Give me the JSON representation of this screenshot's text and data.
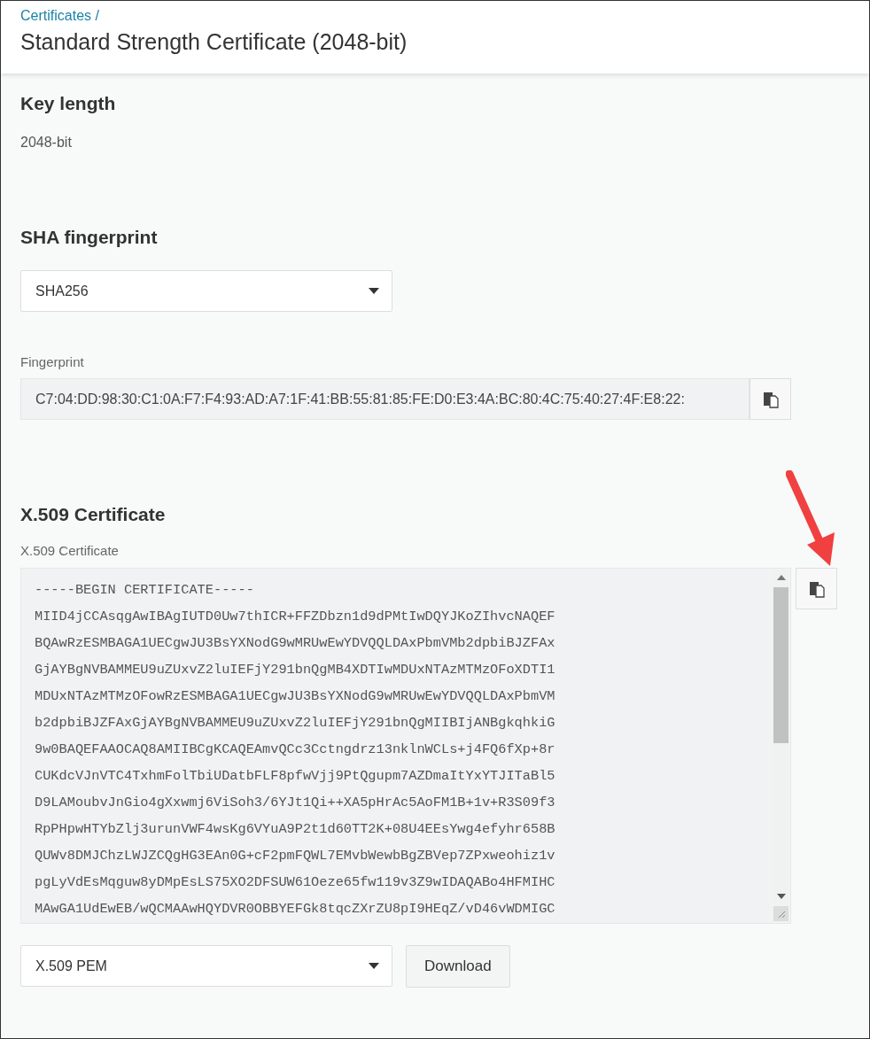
{
  "header": {
    "breadcrumb": "Certificates /",
    "title": "Standard Strength Certificate (2048-bit)"
  },
  "key_length": {
    "heading": "Key length",
    "value": "2048-bit"
  },
  "sha_fingerprint": {
    "heading": "SHA fingerprint",
    "algorithm": "SHA256",
    "field_label": "Fingerprint",
    "fingerprint": "C7:04:DD:98:30:C1:0A:F7:F4:93:AD:A7:1F:41:BB:55:81:85:FE:D0:E3:4A:BC:80:4C:75:40:27:4F:E8:22:"
  },
  "certificate": {
    "heading": "X.509 Certificate",
    "field_label": "X.509 Certificate",
    "lines": [
      "-----BEGIN CERTIFICATE-----",
      "MIID4jCCAsqgAwIBAgIUTD0Uw7thICR+FFZDbzn1d9dPMtIwDQYJKoZIhvcNAQEF",
      "BQAwRzESMBAGA1UECgwJU3BsYXNodG9wMRUwEwYDVQQLDAxPbmVMb2dpbiBJZFAx",
      "GjAYBgNVBAMMEU9uZUxvZ2luIEFjY291bnQgMB4XDTIwMDUxNTAzMTMzOFoXDTI1",
      "MDUxNTAzMTMzOFowRzESMBAGA1UECgwJU3BsYXNodG9wMRUwEwYDVQQLDAxPbmVM",
      "b2dpbiBJZFAxGjAYBgNVBAMMEU9uZUxvZ2luIEFjY291bnQgMIIBIjANBgkqhkiG",
      "9w0BAQEFAAOCAQ8AMIIBCgKCAQEAmvQCc3Cctngdrz13nklnWCLs+j4FQ6fXp+8r",
      "CUKdcVJnVTC4TxhmFolTbiUDatbFLF8pfwVjj9PtQgupm7AZDmaItYxYTJITaBl5",
      "D9LAMoubvJnGio4gXxwmj6ViSoh3/6YJt1Qi++XA5pHrAc5AoFM1B+1v+R3S09f3",
      "RpPHpwHTYbZlj3urunVWF4wsKg6VYuA9P2t1d60TT2K+08U4EEsYwg4efyhr658B",
      "QUWv8DMJChzLWJZCQgHG3EAn0G+cF2pmFQWL7EMvbWewbBgZBVep7ZPxweohiz1v",
      "pgLyVdEsMqguw8yDMpEsLS75XO2DFSUW61Oeze65fw119v3Z9wIDAQABo4HFMIHC",
      "MAwGA1UdEwEB/wQCMAAwHQYDVR0OBBYEFGk8tqcZXrZU8pI9HEqZ/vD46vWDMIGC"
    ],
    "format": "X.509 PEM",
    "download": "Download"
  }
}
